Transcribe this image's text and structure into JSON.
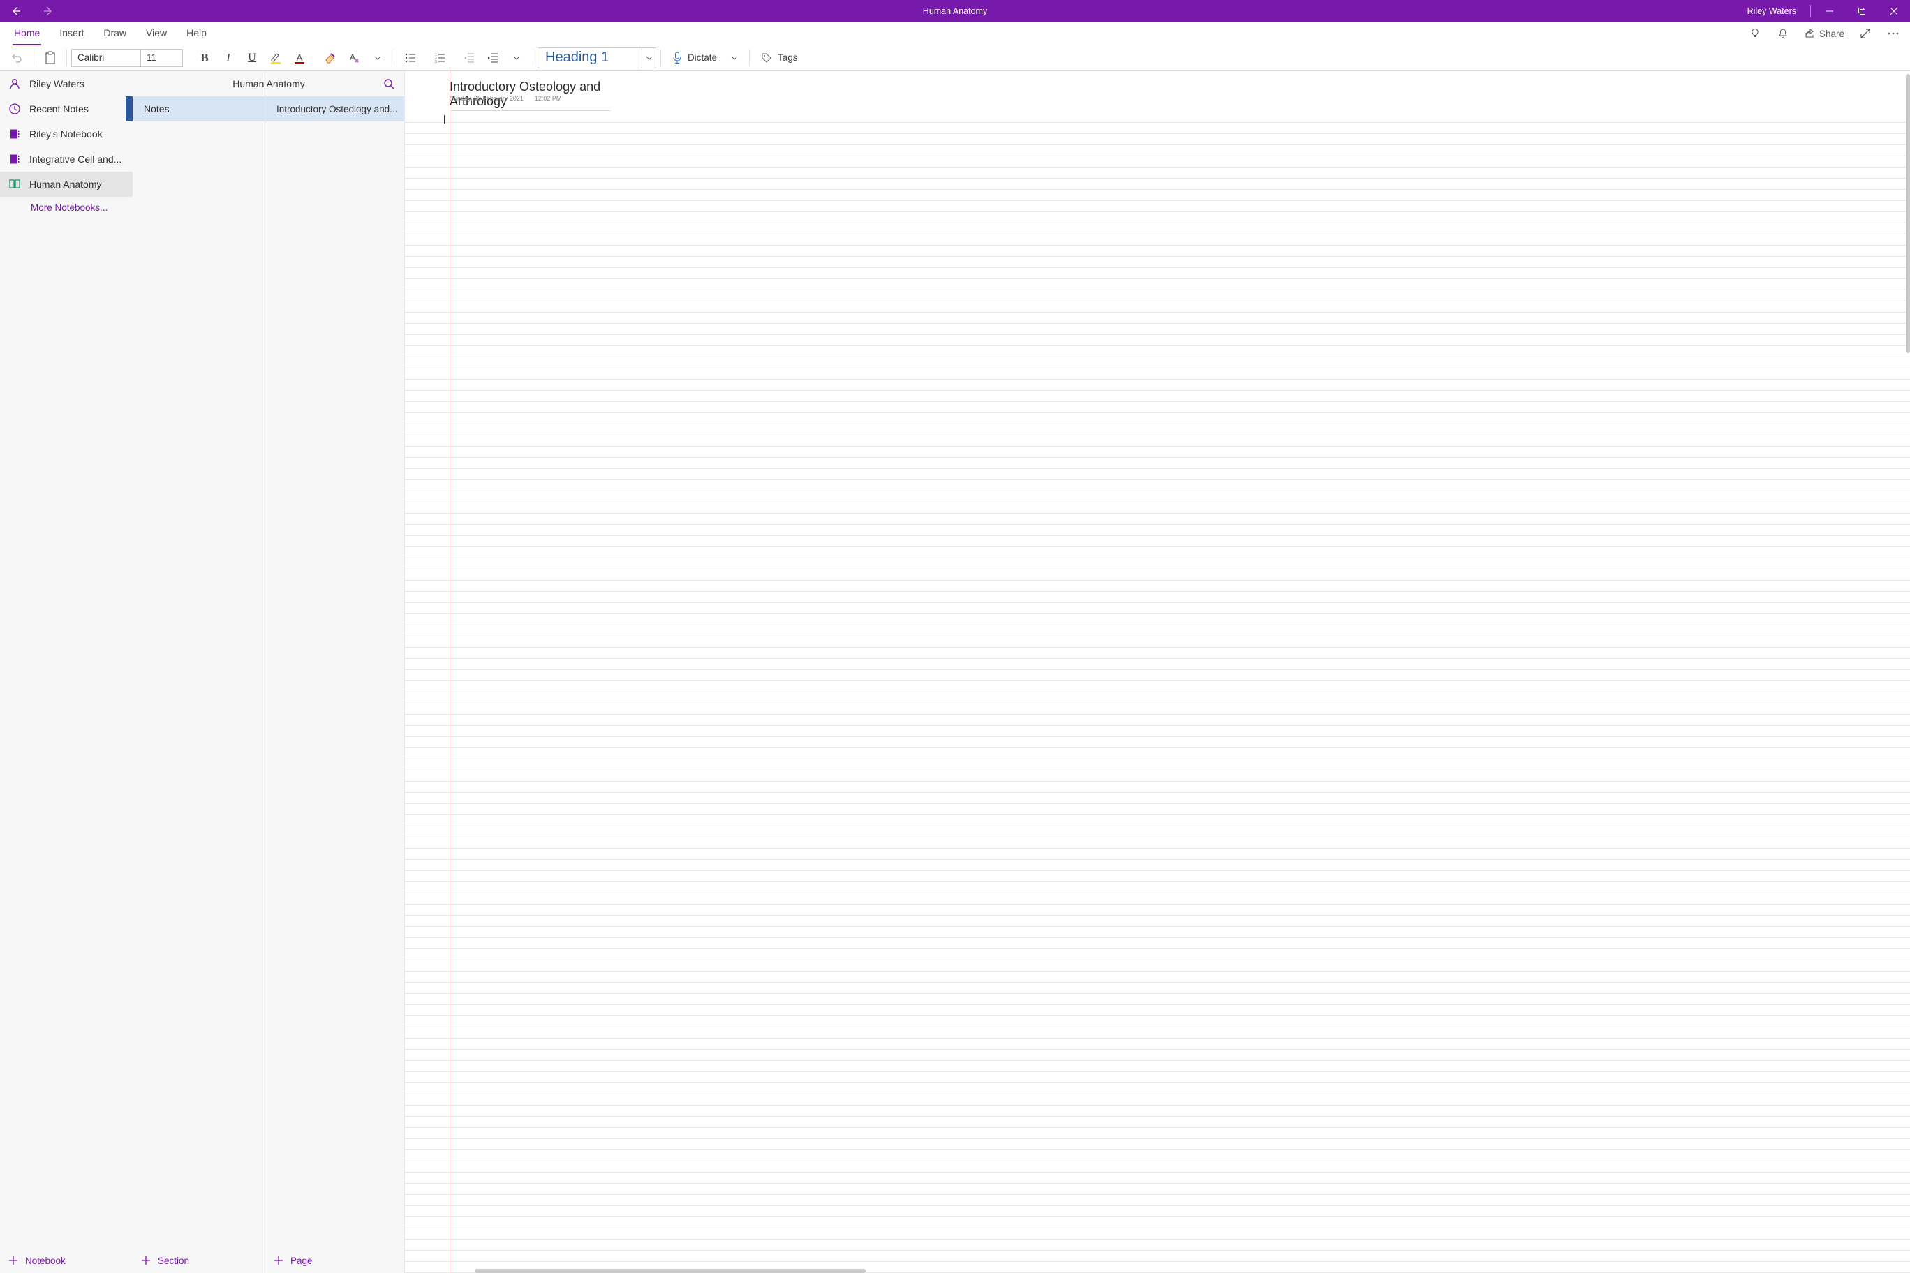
{
  "title_bar": {
    "notebook_title": "Human Anatomy",
    "user_name": "Riley Waters"
  },
  "ribbon": {
    "tabs": [
      "Home",
      "Insert",
      "Draw",
      "View",
      "Help"
    ],
    "active_tab": "Home",
    "share_label": "Share",
    "font_name": "Calibri",
    "font_size": "11",
    "style_name": "Heading 1",
    "dictate_label": "Dictate",
    "tags_label": "Tags"
  },
  "nav": {
    "user": "Riley Waters",
    "recent": "Recent Notes",
    "notebooks": [
      {
        "label": "Riley's Notebook"
      },
      {
        "label": "Integrative Cell and..."
      },
      {
        "label": "Human Anatomy",
        "open": true
      }
    ],
    "more": "More Notebooks...",
    "add_notebook": "Notebook"
  },
  "sections": {
    "header": "Human Anatomy",
    "items": [
      {
        "label": "Notes",
        "selected": true
      }
    ],
    "add": "Section"
  },
  "pages": {
    "items": [
      {
        "label": "Introductory Osteology and...",
        "selected": true
      }
    ],
    "add": "Page"
  },
  "canvas": {
    "page_title": "Introductory Osteology and Arthrology",
    "date": "Sunday, 28 February 2021",
    "time": "12:02 PM"
  }
}
